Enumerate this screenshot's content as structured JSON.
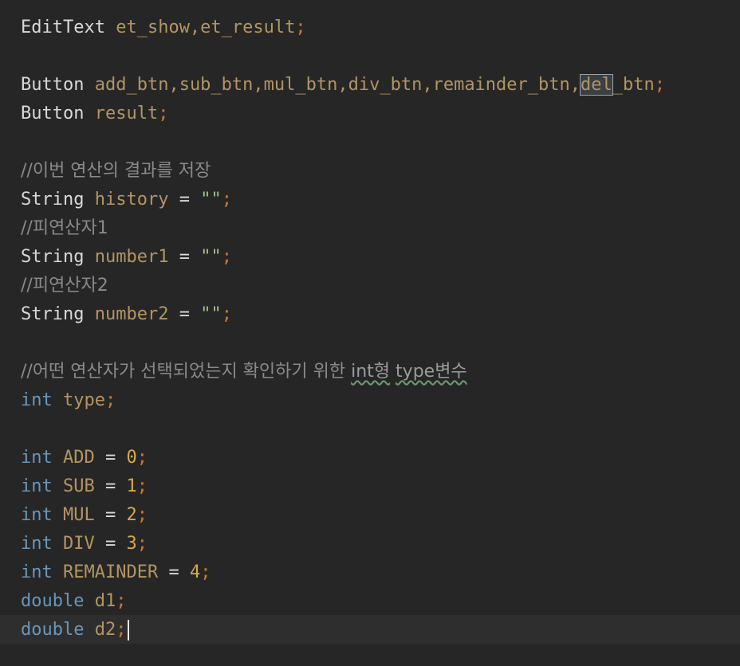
{
  "colors": {
    "background": "#262626",
    "type": "#d9d9d9",
    "keyword": "#6897bb",
    "variable": "#b29562",
    "string": "#a0c080",
    "number": "#d6a84f",
    "comment": "#8a8a8a"
  },
  "code": {
    "l1": {
      "type": "EditText",
      "names": "et_show,et_result",
      "end": ";"
    },
    "l2": {
      "type": "Button",
      "names_before": "add_btn,sub_btn,mul_btn,div_btn,remainder_btn,",
      "selected": "del",
      "names_after": "_btn",
      "end": ";"
    },
    "l3": {
      "type": "Button",
      "names": "result",
      "end": ";"
    },
    "l4": {
      "comment": "//이번 연산의 결과를 저장"
    },
    "l5": {
      "type": "String",
      "name": "history",
      "op": "=",
      "value": "\"\"",
      "end": ";"
    },
    "l6": {
      "comment": "//피연산자1"
    },
    "l7": {
      "type": "String",
      "name": "number1",
      "op": "=",
      "value": "\"\"",
      "end": ";"
    },
    "l8": {
      "comment": "//피연산자2"
    },
    "l9": {
      "type": "String",
      "name": "number2",
      "op": "=",
      "value": "\"\"",
      "end": ";"
    },
    "l10": {
      "comment_pre": "//어떤 연산자가 선택되었는지 확인하기 위한 ",
      "squiggle1": "int형",
      "comment_mid": " ",
      "squiggle2": "type변수"
    },
    "l11": {
      "type": "int",
      "name": "type",
      "end": ";"
    },
    "l12": {
      "type": "int",
      "name": "ADD",
      "op": "=",
      "value": "0",
      "end": ";"
    },
    "l13": {
      "type": "int",
      "name": "SUB",
      "op": "=",
      "value": "1",
      "end": ";"
    },
    "l14": {
      "type": "int",
      "name": "MUL",
      "op": "=",
      "value": "2",
      "end": ";"
    },
    "l15": {
      "type": "int",
      "name": "DIV",
      "op": "=",
      "value": "3",
      "end": ";"
    },
    "l16": {
      "type": "int",
      "name": "REMAINDER",
      "op": "=",
      "value": "4",
      "end": ";"
    },
    "l17": {
      "type": "double",
      "name": "d1",
      "end": ";"
    },
    "l18": {
      "type": "double",
      "name": "d2",
      "end": ";"
    }
  }
}
